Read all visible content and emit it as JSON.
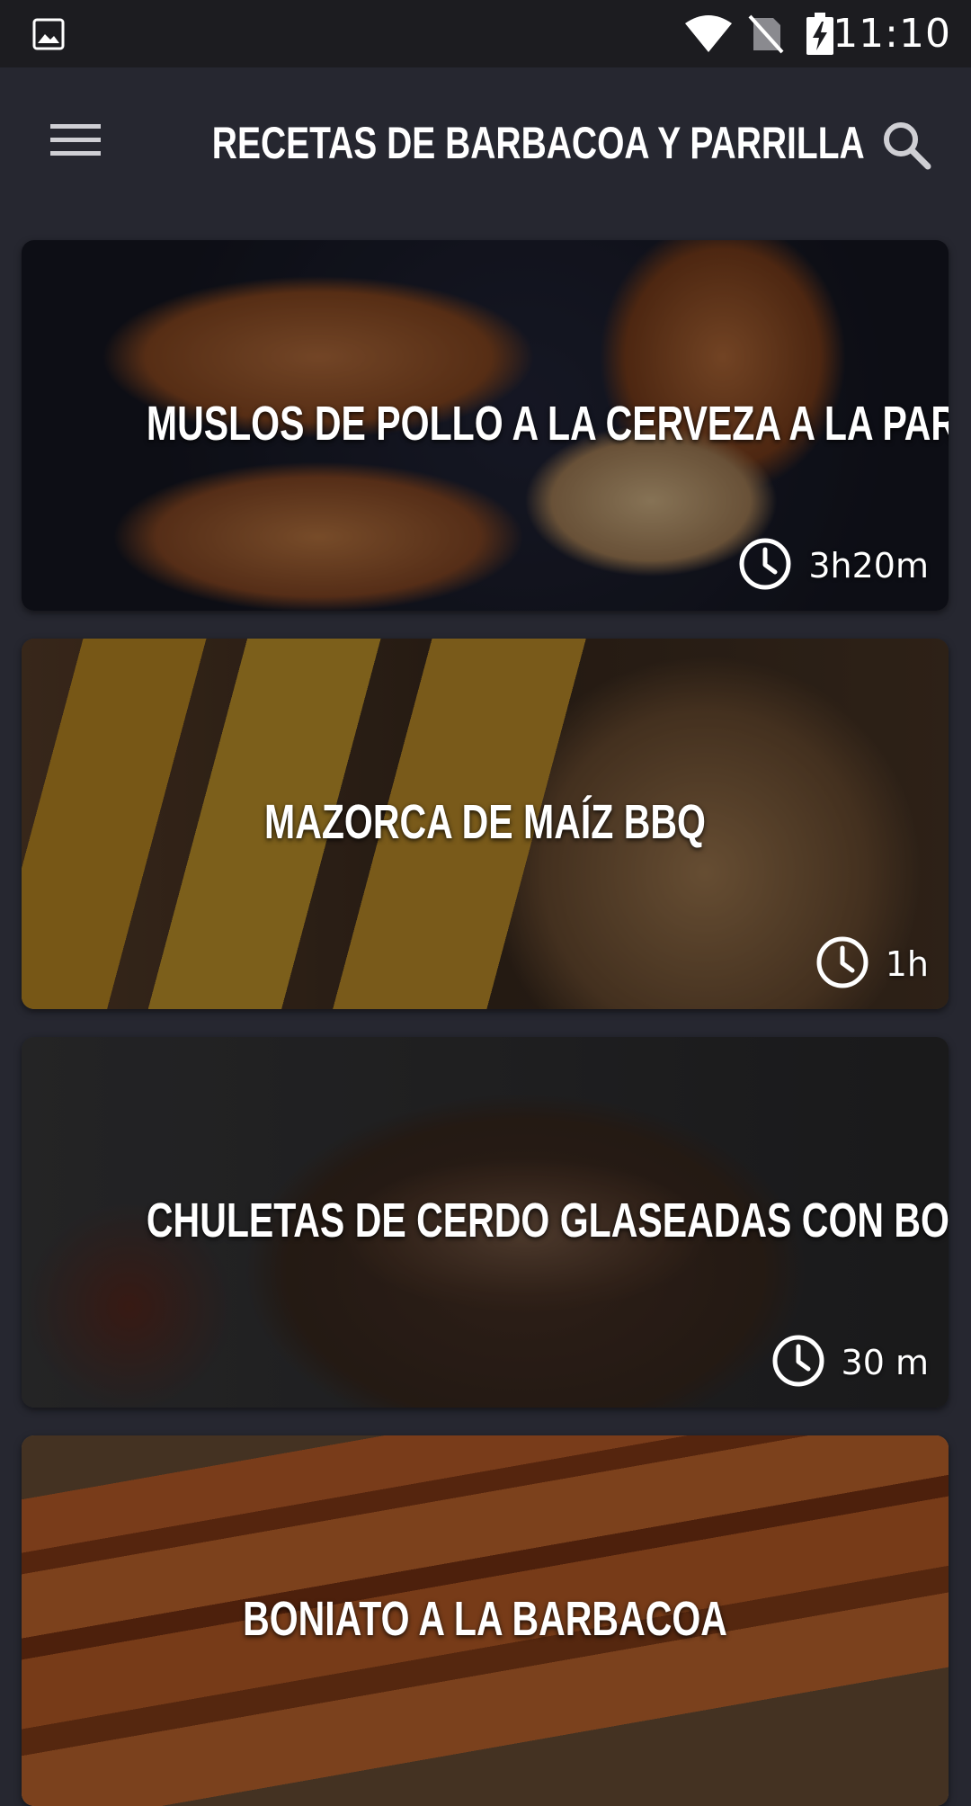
{
  "status_bar": {
    "time": "11:10",
    "icons": [
      "gallery-icon",
      "wifi-icon",
      "no-sim-icon",
      "battery-charging-icon"
    ]
  },
  "app_bar": {
    "title": "RECETAS DE BARBACOA Y PARRILLA",
    "left_icon": "hamburger-menu-icon",
    "right_icon": "search-icon"
  },
  "recipes": [
    {
      "title": "MUSLOS DE POLLO A LA CERVEZA A LA PARRILLA",
      "time": "3h20m"
    },
    {
      "title": "MAZORCA DE MAÍZ BBQ",
      "time": "1h"
    },
    {
      "title": "CHULETAS DE CERDO GLASEADAS CON BOURBON BBQ",
      "time": "30 m"
    },
    {
      "title": "BONIATO A LA BARBACOA",
      "time": ""
    }
  ],
  "colors": {
    "background": "#262730",
    "status_bar": "#1c1c20",
    "text": "#ffffff"
  }
}
